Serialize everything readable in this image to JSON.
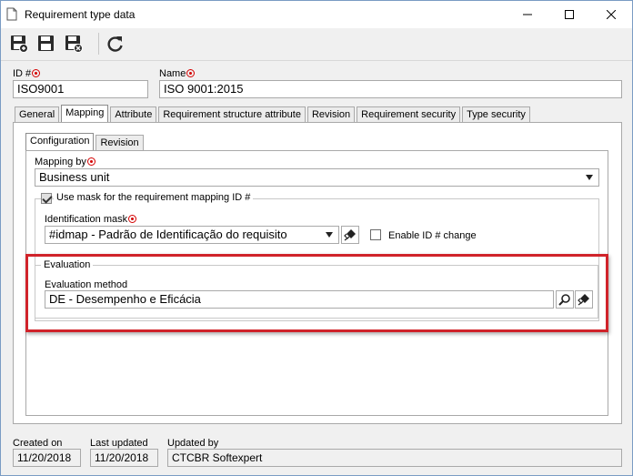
{
  "window": {
    "title": "Requirement type data"
  },
  "toolbar": {
    "buttons": [
      "save-new",
      "save",
      "save-close",
      "refresh"
    ]
  },
  "header": {
    "id_label": "ID #",
    "id_value": "ISO9001",
    "name_label": "Name",
    "name_value": "ISO 9001:2015"
  },
  "tabs": [
    "General",
    "Mapping",
    "Attribute",
    "Requirement structure attribute",
    "Revision",
    "Requirement security",
    "Type security"
  ],
  "active_tab": "Mapping",
  "subtabs": [
    "Configuration",
    "Revision"
  ],
  "active_subtab": "Configuration",
  "mapping": {
    "mapping_by_label": "Mapping by",
    "mapping_by_value": "Business unit",
    "use_mask_label": "Use mask for the requirement mapping ID #",
    "use_mask_checked": true,
    "identification_mask_label": "Identification mask",
    "identification_mask_value": "#idmap - Padrão de Identificação do requisito",
    "enable_id_change_label": "Enable ID # change",
    "enable_id_change_checked": false
  },
  "evaluation": {
    "legend": "Evaluation",
    "method_label": "Evaluation method",
    "method_value": "DE - Desempenho e Eficácia"
  },
  "footer": {
    "created_on_label": "Created on",
    "created_on_value": "11/20/2018",
    "last_updated_label": "Last updated",
    "last_updated_value": "11/20/2018",
    "updated_by_label": "Updated by",
    "updated_by_value": "CTCBR Softexpert"
  },
  "colors": {
    "highlight": "#d0232a",
    "required": "#d40000"
  }
}
